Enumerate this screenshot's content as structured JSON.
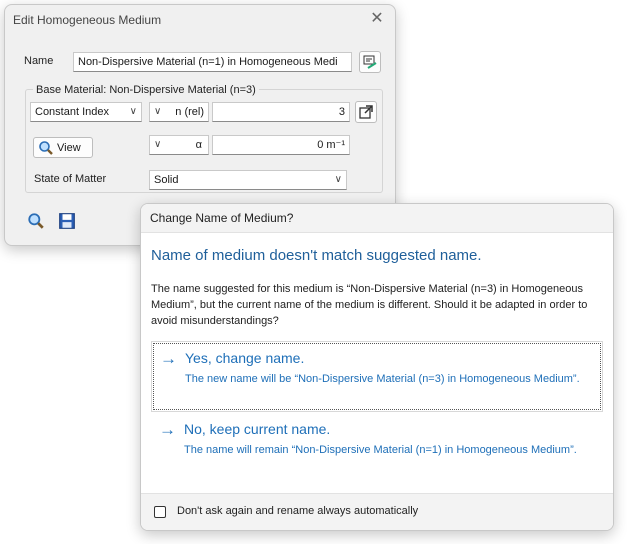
{
  "main_window": {
    "title": "Edit Homogeneous Medium",
    "name_label": "Name",
    "name_value": "Non-Dispersive Material (n=1) in Homogeneous Medi",
    "group_label": "Base Material: Non-Dispersive Material (n=3)",
    "index_type": "Constant Index",
    "n_param": "n (rel)",
    "n_value": "3",
    "view_label": "View",
    "alpha_param": "α",
    "alpha_value": "0 m⁻¹",
    "state_label": "State of Matter",
    "state_value": "Solid"
  },
  "dialog": {
    "title": "Change Name of Medium?",
    "heading": "Name of medium doesn't match suggested name.",
    "message": "The name suggested for this medium is “Non-Dispersive Material (n=3) in Homogeneous Medium”, but the current name of the medium is different. Should it be adapted in order to avoid misunderstandings?",
    "option_yes": {
      "title": "Yes, change name.",
      "desc": "The new name will be “Non-Dispersive Material (n=3) in Homogeneous Medium”."
    },
    "option_no": {
      "title": "No, keep current name.",
      "desc": "The name will remain “Non-Dispersive Material (n=1) in Homogeneous Medium”."
    },
    "checkbox_label": "Don't ask again and rename always automatically"
  },
  "colors": {
    "accent": "#1e6fb8",
    "heading": "#1f5f9a"
  }
}
